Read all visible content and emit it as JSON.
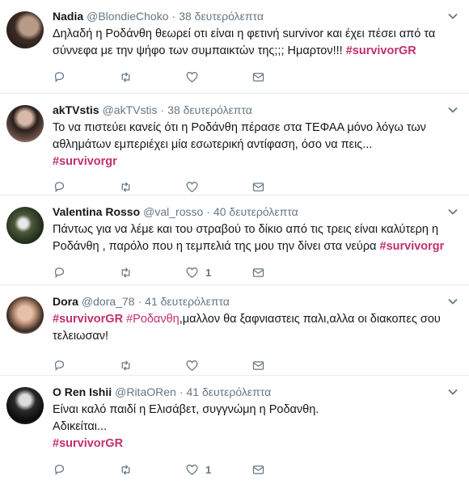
{
  "tweets": [
    {
      "name": "Nadia",
      "handle": "@BlondieChoko",
      "sep": "·",
      "time": "38 δευτερόλεπτα",
      "text": "Δηλαδή η Ροδάνθη θεωρεί οτι είναι η φετινή survivor και έχει πέσει από τα σύννεφα με την ψήφο των συμπαικτών της;;; Ημαρτον!!!",
      "hashtag": "#survivorGR",
      "likes": ""
    },
    {
      "name": "akTVstis",
      "handle": "@akTVstis",
      "sep": "·",
      "time": "38 δευτερόλεπτα",
      "text": "Το να πιστεύει κανείς ότι η Ροδάνθη πέρασε στα ΤΕΦΑΑ μόνο λόγω των αθλημάτων εμπεριέχει μία εσωτερική αντίφαση, όσο να πεις...",
      "hashtag": "#survivorgr",
      "likes": ""
    },
    {
      "name": "Valentina Rosso",
      "handle": "@val_rosso",
      "sep": "·",
      "time": "40 δευτερόλεπτα",
      "text": "Πάντως για να λέμε και του στραβού το δίκιο από τις τρεις είναι καλύτερη η Ροδάνθη , παρόλο που η τεμπελιά της μου την δίνει στα νεύρα ",
      "hashtag": "#survivorgr",
      "likes": "1"
    },
    {
      "name": "Dora",
      "handle": "@dora_78",
      "sep": "·",
      "time": "41 δευτερόλεπτα",
      "hashtag": "#survivorGR",
      "hashtag2": "#Ροδανθη",
      "text": ",μαλλον θα ξαφνιαστεις παλι,αλλα οι διακοπες σου τελειωσαν!",
      "likes": ""
    },
    {
      "name": "O Ren Ishii",
      "handle": "@RitaORen",
      "sep": "·",
      "time": "41 δευτερόλεπτα",
      "text_line1": "Είναι καλό παιδί η Ελισάβετ, συγγνώμη η Ροδανθη.",
      "text_line2": "Αδικείται...",
      "hashtag": "#survivorGR",
      "likes": "1"
    }
  ],
  "icons": [
    "reply-icon",
    "retweet-icon",
    "like-icon",
    "direct-message-icon",
    "chevron-down-icon"
  ],
  "colors": {
    "hashtag": "#c0306f",
    "meta": "#657786",
    "divider": "#e6ecf0"
  }
}
